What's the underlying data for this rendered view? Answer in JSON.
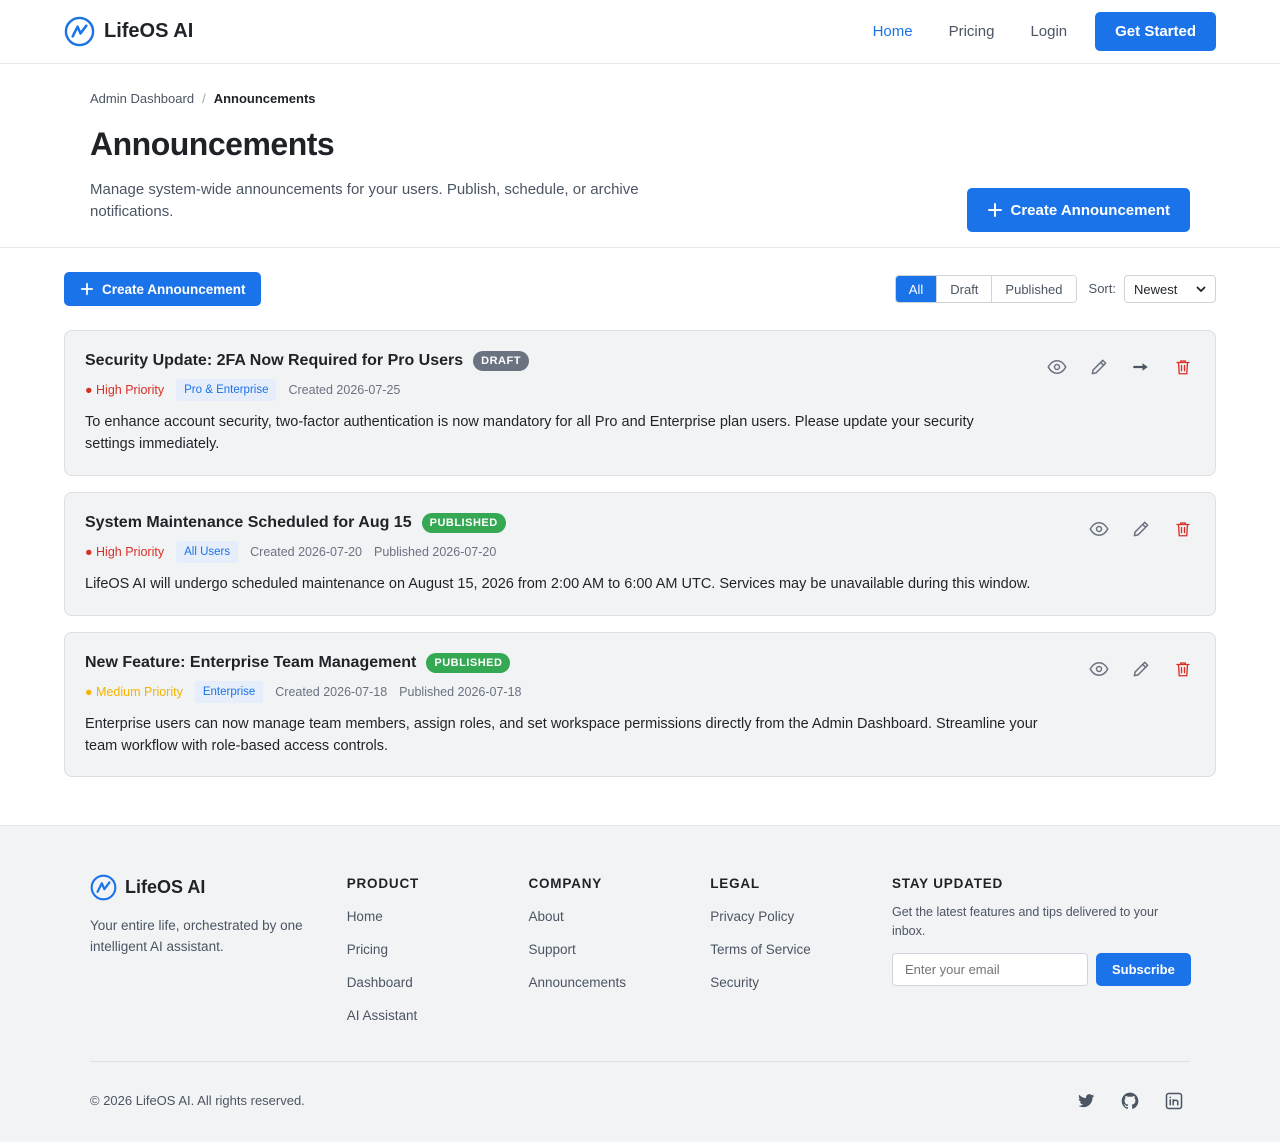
{
  "nav": {
    "brand": "LifeOS AI",
    "links": [
      "Home",
      "Pricing",
      "Login"
    ],
    "cta": "Get Started"
  },
  "header": {
    "breadcrumb": [
      "Admin Dashboard",
      "Announcements"
    ],
    "breadcrumb_sep": "/",
    "title": "Announcements",
    "description": "Manage system-wide announcements for your users. Publish, schedule, or archive notifications.",
    "cta": "Create Announcement"
  },
  "toolbar": {
    "create_label": "Create Announcement",
    "filters": [
      "All",
      "Draft",
      "Published"
    ],
    "active_filter": "All",
    "sort_label": "Sort:",
    "sort_value": "Newest"
  },
  "announcements": [
    {
      "title": "Security Update: 2FA Now Required for Pro Users",
      "status": "DRAFT",
      "priority": "● High Priority",
      "audience": "Pro & Enterprise",
      "created": "Created 2026-07-25",
      "published": "",
      "body": "To enhance account security, two-factor authentication is now mandatory for all Pro and Enterprise plan users. Please update your security settings immediately."
    },
    {
      "title": "System Maintenance Scheduled for Aug 15",
      "status": "PUBLISHED",
      "priority": "● High Priority",
      "audience": "All Users",
      "created": "Created 2026-07-20",
      "published": "Published 2026-07-20",
      "body": "LifeOS AI will undergo scheduled maintenance on August 15, 2026 from 2:00 AM to 6:00 AM UTC. Services may be unavailable during this window."
    },
    {
      "title": "New Feature: Enterprise Team Management",
      "status": "PUBLISHED",
      "priority": "● Medium Priority",
      "audience": "Enterprise",
      "created": "Created 2026-07-18",
      "published": "Published 2026-07-18",
      "body": "Enterprise users can now manage team members, assign roles, and set workspace permissions directly from the Admin Dashboard. Streamline your team workflow with role-based access controls."
    }
  ],
  "footer": {
    "brand": "LifeOS AI",
    "tagline": "Your entire life, orchestrated by one intelligent AI assistant.",
    "product": {
      "heading": "PRODUCT",
      "links": [
        "Home",
        "Pricing",
        "Dashboard",
        "AI Assistant"
      ]
    },
    "company": {
      "heading": "COMPANY",
      "links": [
        "About",
        "Support",
        "Announcements"
      ]
    },
    "legal": {
      "heading": "LEGAL",
      "links": [
        "Privacy Policy",
        "Terms of Service",
        "Security"
      ]
    },
    "stay": {
      "heading": "STAY UPDATED",
      "description": "Get the latest features and tips delivered to your inbox.",
      "email_placeholder": "Enter your email",
      "subscribe": "Subscribe"
    },
    "copyright": "© 2026 LifeOS AI. All rights reserved."
  },
  "colors": {
    "primary": "#1a73e8",
    "draft": "#6b7280",
    "published": "#34a853",
    "high_priority": "#d93025",
    "medium_priority": "#f4b400",
    "delete": "#d93025"
  },
  "icons": {
    "logo": "logo-icon",
    "plus": "plus-icon",
    "view": "eye-icon",
    "edit": "pencil-icon",
    "publish": "arrow-right-icon",
    "delete": "trash-icon",
    "twitter": "twitter-icon",
    "github": "github-icon",
    "linkedin": "linkedin-icon"
  }
}
